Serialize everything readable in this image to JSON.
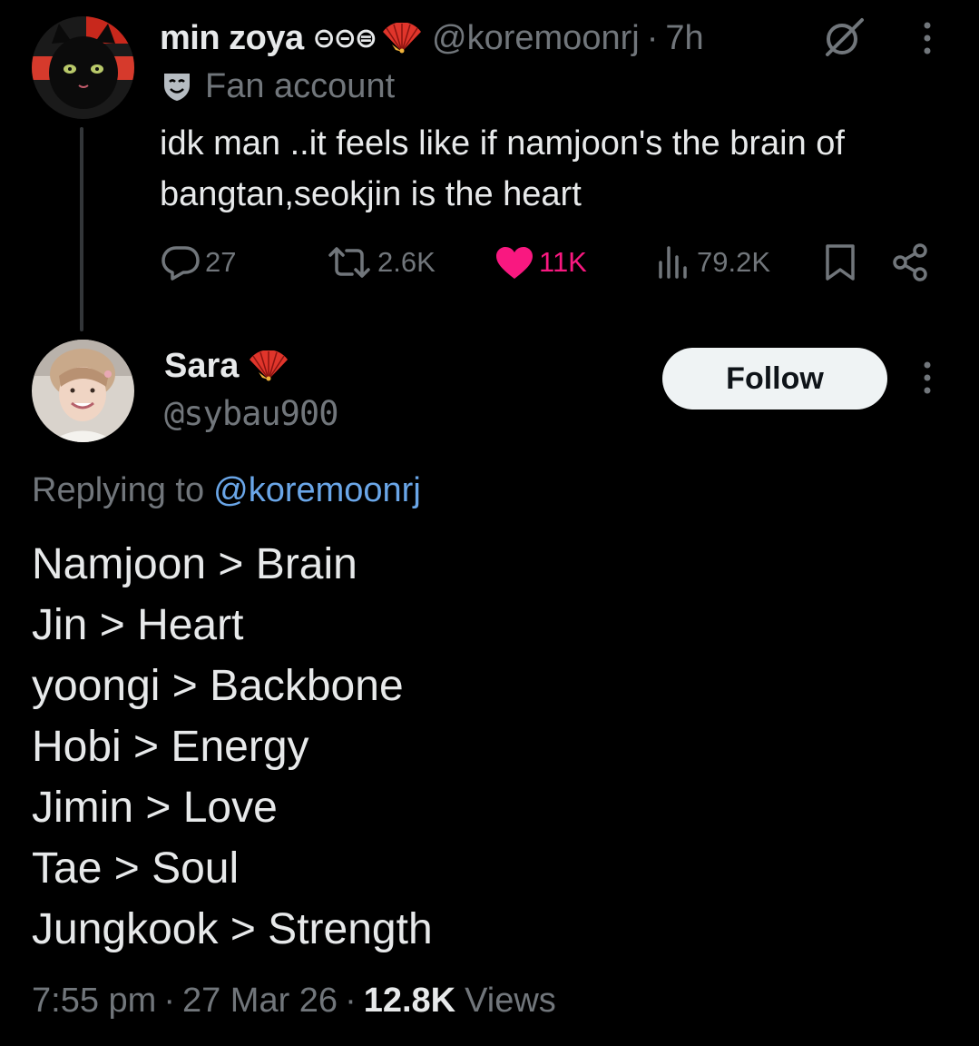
{
  "parent_tweet": {
    "display_name": "min zoya",
    "name_emoji": "⊝⊝⊜",
    "handle": "@koremoonrj",
    "time_separator": "·",
    "time": "7h",
    "badge_label": "Fan account",
    "text_lines": [
      "idk man ..it feels like if namjoon's the brain of",
      "bangtan,seokjin is the heart"
    ],
    "stats": {
      "replies": "27",
      "reposts": "2.6K",
      "likes": "11K",
      "views": "79.2K"
    },
    "colors": {
      "like": "#f91880",
      "muted": "#71767b"
    }
  },
  "reply_tweet": {
    "display_name": "Sara",
    "handle": "@sybau900",
    "follow_label": "Follow",
    "replying_prefix": "Replying to",
    "replying_mention": "@koremoonrj",
    "lines": [
      "Namjoon > Brain",
      "Jin > Heart",
      "yoongi > Backbone",
      "Hobi > Energy",
      "Jimin > Love",
      "Tae > Soul",
      "Jungkook > Strength"
    ],
    "meta": {
      "time": "7:55 pm",
      "sep1": "·",
      "date": "27 Mar 26",
      "sep2": "·",
      "views_count": "12.8K",
      "views_label": "Views"
    },
    "colors": {
      "mention": "#6aa6e8",
      "follow_bg": "#eff3f4"
    }
  },
  "icons": [
    "reply-icon",
    "repost-icon",
    "like-icon",
    "views-icon",
    "bookmark-icon",
    "share-icon",
    "grok-icon",
    "more-icon",
    "fan-account-badge-icon",
    "fan-emoji-icon"
  ]
}
